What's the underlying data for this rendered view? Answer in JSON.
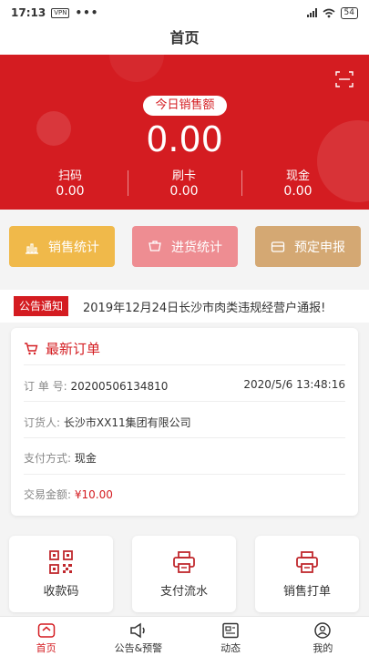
{
  "status": {
    "time": "17:13",
    "vpn": "VPN",
    "dots": "•••",
    "battery": "54"
  },
  "header": {
    "title": "首页"
  },
  "sales": {
    "label": "今日销售额",
    "total": "0.00",
    "metrics": [
      {
        "label": "扫码",
        "value": "0.00"
      },
      {
        "label": "刷卡",
        "value": "0.00"
      },
      {
        "label": "现金",
        "value": "0.00"
      }
    ]
  },
  "quick_actions": [
    {
      "label": "销售统计",
      "color": "#f0b94a"
    },
    {
      "label": "进货统计",
      "color": "#ee8d92"
    },
    {
      "label": "预定申报",
      "color": "#d4a873"
    }
  ],
  "notice": {
    "tag": "公告通知",
    "text": "2019年12月24日长沙市肉类违规经营户通报!"
  },
  "order": {
    "title": "最新订单",
    "number_label": "订 单 号:",
    "number": "20200506134810",
    "datetime": "2020/5/6 13:48:16",
    "buyer_label": "订货人:",
    "buyer": "长沙市XX11集团有限公司",
    "payment_label": "支付方式:",
    "payment": "现金",
    "amount_label": "交易金额:",
    "amount": "¥10.00"
  },
  "actions": [
    {
      "label": "收款码",
      "icon": "qr-code-icon"
    },
    {
      "label": "支付流水",
      "icon": "printer-icon"
    },
    {
      "label": "销售打单",
      "icon": "printer-icon"
    }
  ],
  "tabs": [
    {
      "label": "首页",
      "icon": "home-icon",
      "active": true
    },
    {
      "label": "公告&预警",
      "icon": "megaphone-icon",
      "active": false
    },
    {
      "label": "动态",
      "icon": "news-icon",
      "active": false
    },
    {
      "label": "我的",
      "icon": "user-icon",
      "active": false
    }
  ],
  "colors": {
    "brand_red": "#d41c21"
  }
}
